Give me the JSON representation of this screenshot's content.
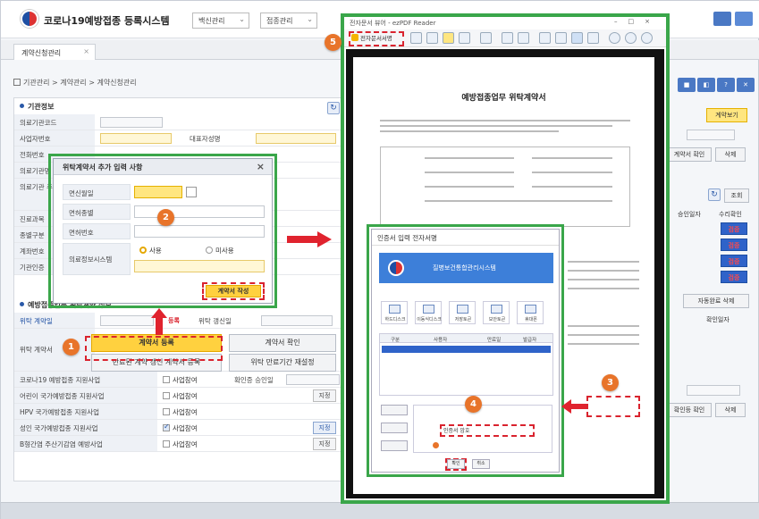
{
  "app": {
    "title": "코로나19예방접종 등록시스템",
    "menu1": "백신관리",
    "menu2": "접종관리",
    "tab_label": "계약신청관리",
    "breadcrumb": "기관관리 > 계약관리 > 계약신청관리",
    "right_buttons": [
      "■",
      "◧",
      "?",
      "✕"
    ]
  },
  "form": {
    "section_institution": "기관정보",
    "rows": [
      {
        "label": "의료기관코드"
      },
      {
        "label": "사업자번호",
        "side_label": "대표자성명"
      },
      {
        "label": "전화번호"
      },
      {
        "label": "의료기관명"
      },
      {
        "label": "의료기관 주소"
      },
      {
        "label": "진료과목"
      },
      {
        "label": "종별구분"
      },
      {
        "label": "계좌번호"
      },
      {
        "label": "기관인증"
      }
    ],
    "section_contract": "예방접종업무 위탁계약 정보",
    "contract_date_label": "위탁 계약일",
    "renewal_label": "위탁 갱신일",
    "contract_doc_label": "위탁 계약서",
    "btn_register": "계약서 등록",
    "btn_view": "계약서 확인",
    "btn_reg_link": "등록",
    "btn_expired_register": "만료된 계약 갱신 계약서 등록",
    "btn_expired_view": "위탁 만료기간 재설정",
    "programs": [
      {
        "label": "코로나19 예방접종 지원사업",
        "chk": "사업참여",
        "checked": false,
        "extra": "확인증 승인일"
      },
      {
        "label": "어린이 국가예방접종 지원사업",
        "chk": "사업참여",
        "checked": false,
        "extra": "지정"
      },
      {
        "label": "HPV 국가예방접종 지원사업",
        "chk": "사업참여",
        "checked": false,
        "extra": ""
      },
      {
        "label": "성인 국가예방접종 지원사업",
        "chk": "사업참여",
        "checked": true,
        "extra": "지정"
      },
      {
        "label": "B형간염 주산기감염 예방사업",
        "chk": "사업참여",
        "checked": false,
        "extra": "지정"
      }
    ]
  },
  "popup1": {
    "title": "위탁계약서 추가 입력 사항",
    "rows": [
      {
        "label": "면신월일"
      },
      {
        "label": "면허종별"
      },
      {
        "label": "면허번호"
      },
      {
        "label": "의료정보시스템"
      }
    ],
    "radio_use": "사용",
    "radio_nouse": "미사용",
    "btn_create": "계약서 작성"
  },
  "viewer": {
    "window_title": "전자문서 뷰어 - ezPDF Reader",
    "sign_button": "전자문서서명",
    "doc_title": "예방접종업무 위탁계약서",
    "sig_dialog": {
      "title": "인증서 입력 전자서명",
      "banner": "질병보건통합관리시스템",
      "locations": [
        "하드디스크",
        "이동식디스크",
        "저장토큰",
        "보안토큰",
        "휴대폰"
      ],
      "cert_headers": [
        "구분",
        "사용자",
        "만료일",
        "발급자"
      ],
      "label_pw": "인증서 암호",
      "btn_ok": "확인",
      "btn_cancel": "취소"
    }
  },
  "right_panel": {
    "btn_top": "계약보기",
    "btn_view_check": "계약서 확인",
    "btn_delete": "삭제",
    "btn_search": "조회",
    "col_approve": "승인일자",
    "col_confirm": "수리확인",
    "statuses": [
      "검증",
      "검증",
      "검증",
      "검증"
    ],
    "btn_doc_delete": "자동완료 삭제",
    "col_confirm_date": "확인일자",
    "btn_view_check2": "확인등 확인",
    "btn_delete2": "삭제"
  },
  "badges": [
    "1",
    "2",
    "3",
    "4",
    "5"
  ]
}
